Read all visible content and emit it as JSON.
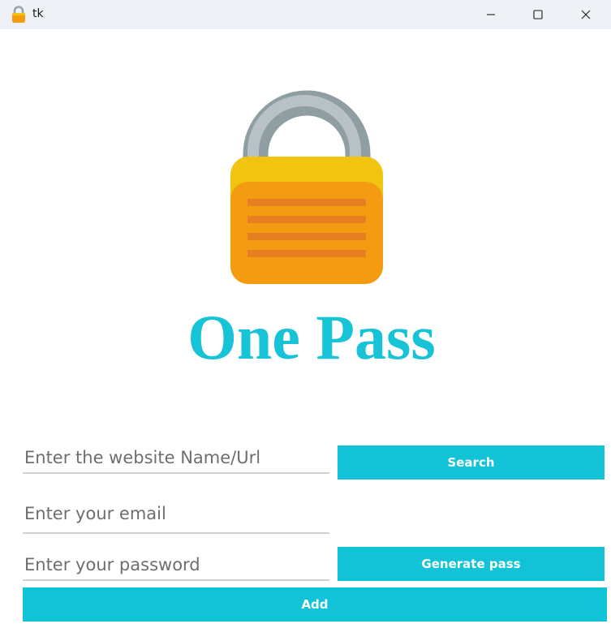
{
  "window": {
    "title": "tk",
    "icon": "lock-icon",
    "controls": [
      "minimize-icon",
      "maximize-icon",
      "close-icon"
    ]
  },
  "brand": {
    "logo": "padlock-icon",
    "title": "One Pass"
  },
  "form": {
    "website_placeholder": "Enter the website Name/Url",
    "email_placeholder": "Enter your email",
    "password_placeholder": "Enter your password",
    "search_label": "Search",
    "generate_label": "Generate pass",
    "add_label": "Add"
  },
  "colors": {
    "accent": "#12c3d8",
    "lock_body": "#f39c12",
    "lock_top": "#f1c40f",
    "shackle": "#95a5a6"
  }
}
